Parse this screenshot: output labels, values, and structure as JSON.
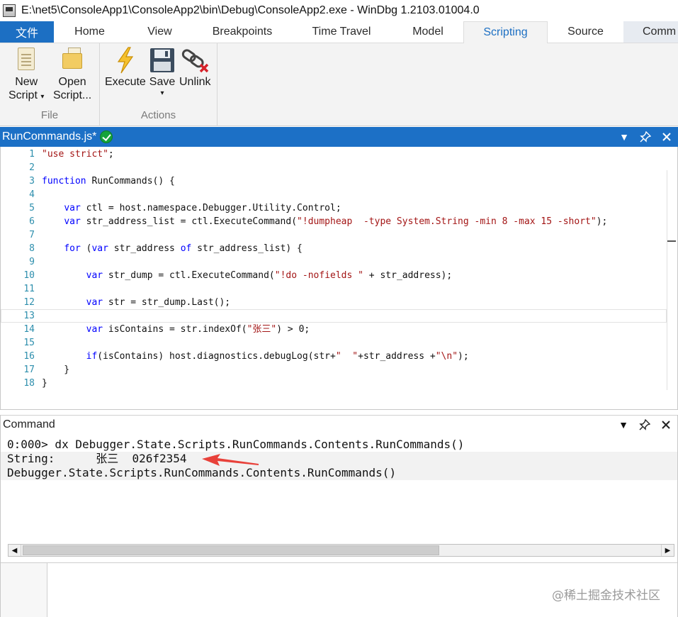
{
  "window": {
    "title": "E:\\net5\\ConsoleApp1\\ConsoleApp2\\bin\\Debug\\ConsoleApp2.exe  - WinDbg 1.2103.01004.0"
  },
  "ribbon": {
    "tabs": [
      "文件",
      "Home",
      "View",
      "Breakpoints",
      "Time Travel",
      "Model",
      "Scripting",
      "Source",
      "Comm"
    ],
    "active_tab": "Scripting",
    "groups": {
      "file": {
        "label": "File",
        "new_label_1": "New",
        "new_label_2": "Script",
        "open_label_1": "Open",
        "open_label_2": "Script..."
      },
      "actions": {
        "label": "Actions",
        "execute_label": "Execute",
        "save_label": "Save",
        "unlink_label": "Unlink"
      }
    }
  },
  "editor": {
    "doc_title": "RunCommands.js*",
    "current_line": 13,
    "lines": [
      {
        "n": "1",
        "text": "\"use strict\";"
      },
      {
        "n": "2",
        "text": ""
      },
      {
        "n": "3",
        "text": "function RunCommands() {"
      },
      {
        "n": "4",
        "text": ""
      },
      {
        "n": "5",
        "text": "    var ctl = host.namespace.Debugger.Utility.Control;"
      },
      {
        "n": "6",
        "text": "    var str_address_list = ctl.ExecuteCommand(\"!dumpheap  -type System.String -min 8 -max 15 -short\");"
      },
      {
        "n": "7",
        "text": ""
      },
      {
        "n": "8",
        "text": "    for (var str_address of str_address_list) {"
      },
      {
        "n": "9",
        "text": ""
      },
      {
        "n": "10",
        "text": "        var str_dump = ctl.ExecuteCommand(\"!do -nofields \" + str_address);"
      },
      {
        "n": "11",
        "text": ""
      },
      {
        "n": "12",
        "text": "        var str = str_dump.Last();"
      },
      {
        "n": "13",
        "text": ""
      },
      {
        "n": "14",
        "text": "        var isContains = str.indexOf(\"张三\") > 0;"
      },
      {
        "n": "15",
        "text": ""
      },
      {
        "n": "16",
        "text": "        if(isContains) host.diagnostics.debugLog(str+\"  \"+str_address +\"\\n\");"
      },
      {
        "n": "17",
        "text": "    }"
      },
      {
        "n": "18",
        "text": "}"
      }
    ]
  },
  "command": {
    "panel_title": "Command",
    "output": [
      "0:000> dx Debugger.State.Scripts.RunCommands.Contents.RunCommands()",
      "String:      张三  026f2354",
      "Debugger.State.Scripts.RunCommands.Contents.RunCommands()"
    ],
    "input_value": ""
  },
  "watermark": "@稀土掘金技术社区",
  "colors": {
    "accent": "#1c70c6",
    "saved_check": "#14a33a",
    "annotation_arrow": "#e8413a",
    "keyword": "#0000ff",
    "string": "#a31515",
    "line_number": "#2e8fad"
  },
  "icons": {
    "new_script": "new-script-icon",
    "open_script": "open-script-icon",
    "execute": "lightning-icon",
    "save": "floppy-disk-icon",
    "unlink": "unlink-chain-icon"
  }
}
